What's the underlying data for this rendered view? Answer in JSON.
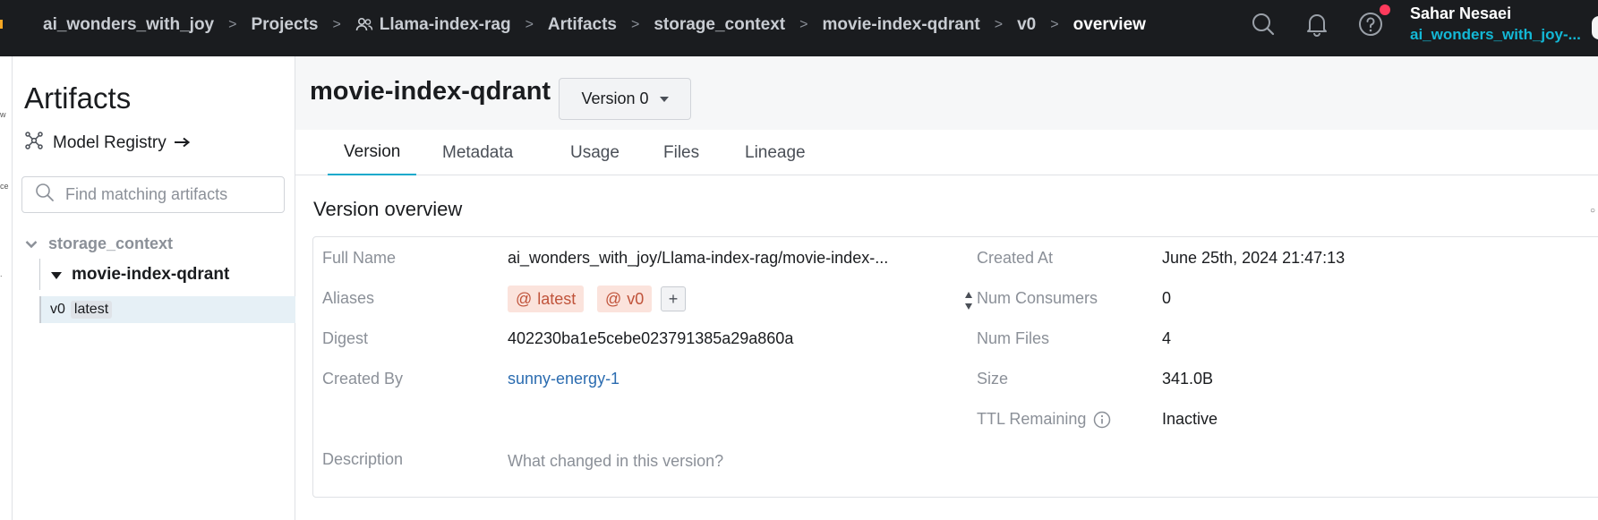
{
  "breadcrumbs": [
    "ai_wonders_with_joy",
    "Projects",
    "Llama-index-rag",
    "Artifacts",
    "storage_context",
    "movie-index-qdrant",
    "v0",
    "overview"
  ],
  "user": {
    "name": "Sahar Nesaei",
    "org": "ai_wonders_with_joy-..."
  },
  "sidebar": {
    "title": "Artifacts",
    "model_registry": "Model Registry",
    "search_placeholder": "Find matching artifacts",
    "tree": {
      "type": "storage_context",
      "artifact": "movie-index-qdrant",
      "version": "v0",
      "version_tag": "latest"
    }
  },
  "header": {
    "artifact_name": "movie-index-qdrant",
    "version_select": "Version 0"
  },
  "tabs": [
    "Version",
    "Metadata",
    "Usage",
    "Files",
    "Lineage"
  ],
  "overview": {
    "title": "Version overview",
    "left": {
      "full_name_label": "Full Name",
      "full_name": "ai_wonders_with_joy/Llama-index-rag/movie-index-...",
      "aliases_label": "Aliases",
      "aliases": [
        "latest",
        "v0"
      ],
      "alias_add": "+",
      "digest_label": "Digest",
      "digest": "402230ba1e5cebe023791385a29a860a",
      "created_by_label": "Created By",
      "created_by": "sunny-energy-1",
      "description_label": "Description",
      "description_placeholder": "What changed in this version?"
    },
    "right": {
      "created_at_label": "Created At",
      "created_at": "June 25th, 2024 21:47:13",
      "num_consumers_label": "Num Consumers",
      "num_consumers": "0",
      "num_files_label": "Num Files",
      "num_files": "4",
      "size_label": "Size",
      "size": "341.0B",
      "ttl_label": "TTL Remaining",
      "ttl": "Inactive"
    }
  },
  "colors": {
    "topbar": "#1a1c1f",
    "accent": "#13a9cc",
    "alias_bg": "#fbe3dc",
    "alias_fg": "#c0533a",
    "notification": "#ff3b5c"
  }
}
